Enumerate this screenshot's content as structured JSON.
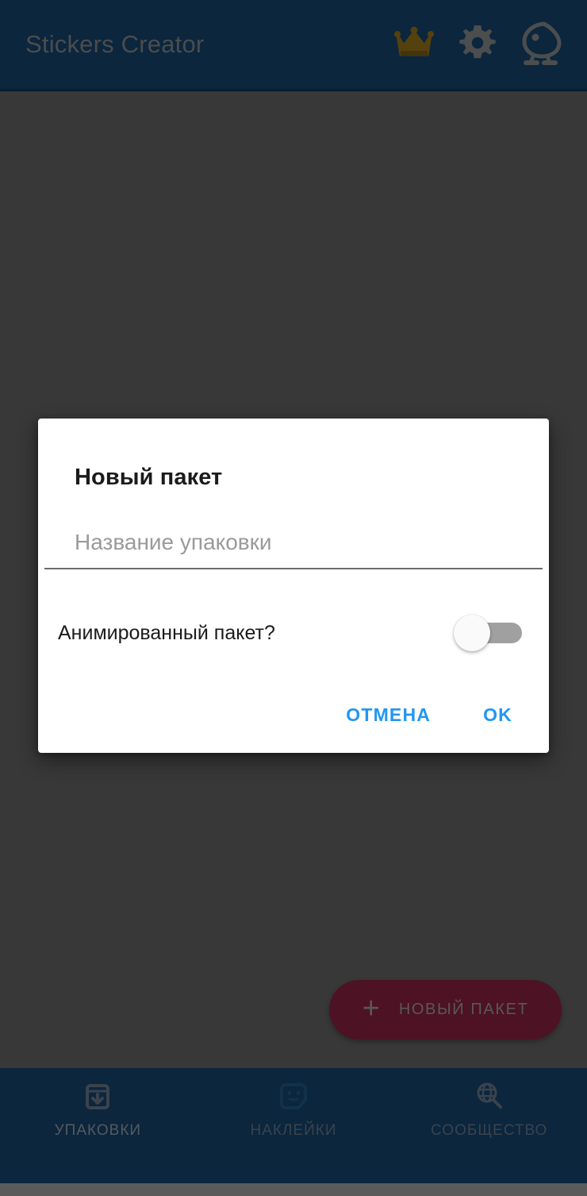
{
  "app": {
    "title": "Stickers Creator",
    "topbar_bg": "#123e63",
    "accent_crown": "#8a6a17"
  },
  "topbar": {
    "actions": [
      {
        "name": "premium-crown-icon",
        "label": "crown-icon"
      },
      {
        "name": "settings-icon",
        "label": "gear-icon"
      },
      {
        "name": "mascot-icon",
        "label": "bird-mascot-icon"
      }
    ]
  },
  "fab": {
    "plus": "+",
    "label": "НОВЫЙ ПАКЕТ",
    "color": "#7d1e3b"
  },
  "bottom_nav": {
    "items": [
      {
        "label": "УПАКОВКИ",
        "icon": "archive-download-icon",
        "selected": true
      },
      {
        "label": "НАКЛЕЙКИ",
        "icon": "sticker-face-icon",
        "selected": false
      },
      {
        "label": "СООБЩЕСТВО",
        "icon": "globe-search-icon",
        "selected": false
      }
    ]
  },
  "dialog": {
    "title": "Новый пакет",
    "name_field": {
      "value": "",
      "placeholder": "Название упаковки"
    },
    "animated": {
      "label": "Анимированный пакет?",
      "state": "off"
    },
    "buttons": {
      "cancel": "ОТМЕНА",
      "ok": "OK"
    },
    "button_color": "#2196f3"
  }
}
